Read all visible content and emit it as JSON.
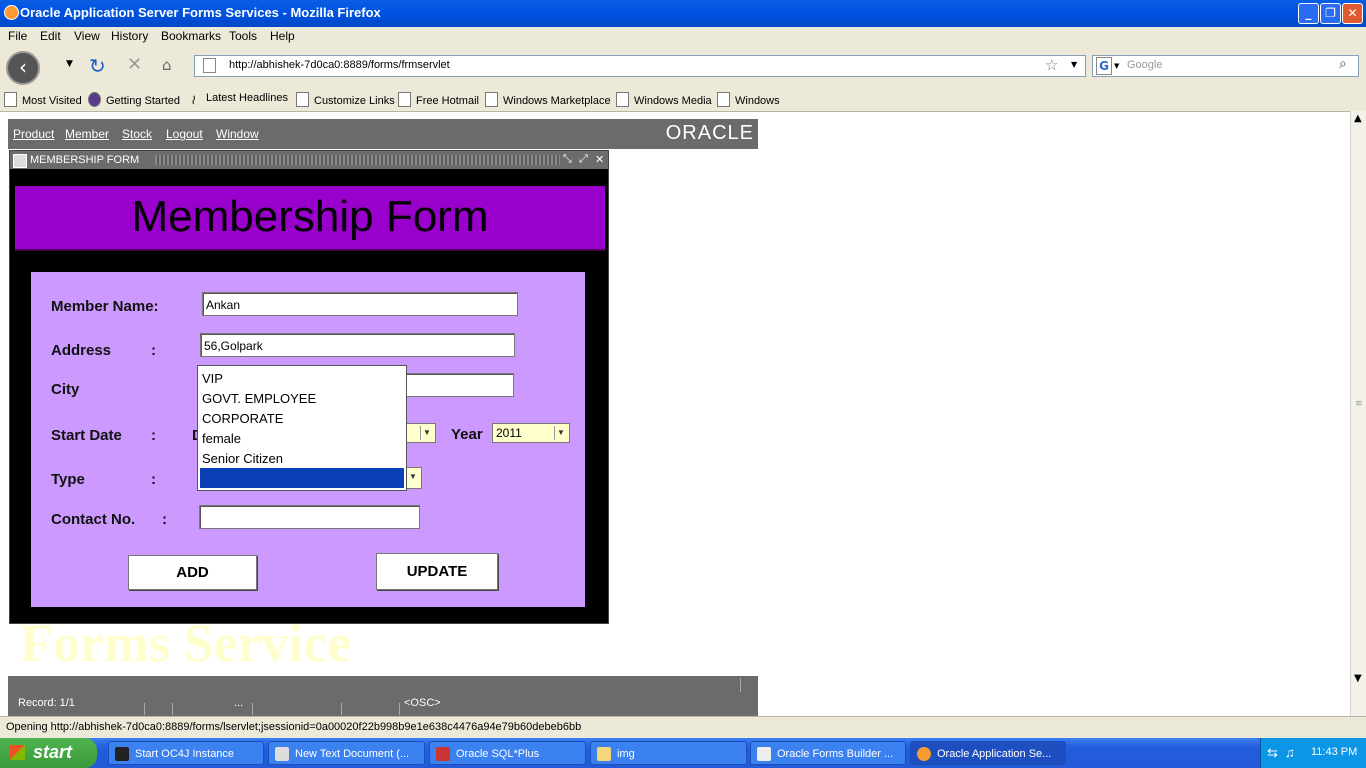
{
  "window": {
    "title": "Oracle Application Server Forms Services - Mozilla Firefox"
  },
  "menu": [
    "File",
    "Edit",
    "View",
    "History",
    "Bookmarks",
    "Tools",
    "Help"
  ],
  "navigation": {
    "url": "http://abhishek-7d0ca0:8889/forms/frmservlet",
    "search_placeholder": "Google",
    "search_engine_icon": "G"
  },
  "bookmarks": [
    "Most Visited",
    "Getting Started",
    "Latest Headlines",
    "Customize Links",
    "Free Hotmail",
    "Windows Marketplace",
    "Windows Media",
    "Windows"
  ],
  "applet": {
    "menu": [
      "Product",
      "Member",
      "Stock",
      "Logout",
      "Window"
    ],
    "logo": "ORACLE",
    "watermark": "Forms Service",
    "status": {
      "record": "Record: 1/1",
      "ellipsis": "...",
      "osc": "<OSC>"
    }
  },
  "form_window": {
    "title": "MEMBERSHIP FORM",
    "header": "Membership Form",
    "labels": {
      "member_name": "Member Name:",
      "address": "Address",
      "address_colon": ":",
      "city": "City",
      "start_date": "Start Date",
      "start_date_colon": ":",
      "start_date_partial": "D",
      "year": "Year",
      "type": "Type",
      "type_colon": ":",
      "contact": "Contact No.",
      "contact_colon": ":"
    },
    "values": {
      "member_name": "Ankan",
      "address": "56,Golpark",
      "city": "",
      "year": "2011",
      "type": "",
      "contact": ""
    },
    "type_options": [
      "VIP",
      "GOVT. EMPLOYEE",
      "CORPORATE",
      "female",
      "Senior Citizen"
    ],
    "buttons": {
      "add": "ADD",
      "update": "UPDATE"
    }
  },
  "status_bar": {
    "text": "Opening http://abhishek-7d0ca0:8889/forms/lservlet;jsessionid=0a00020f22b998b9e1e638c4476a94e79b60debeb6bb"
  },
  "taskbar": {
    "start": "start",
    "tasks": [
      "Start OC4J Instance",
      "New Text Document (...",
      "Oracle SQL*Plus",
      "img",
      "Oracle Forms Builder ...",
      "Oracle Application Se..."
    ],
    "clock": "11:43 PM"
  }
}
